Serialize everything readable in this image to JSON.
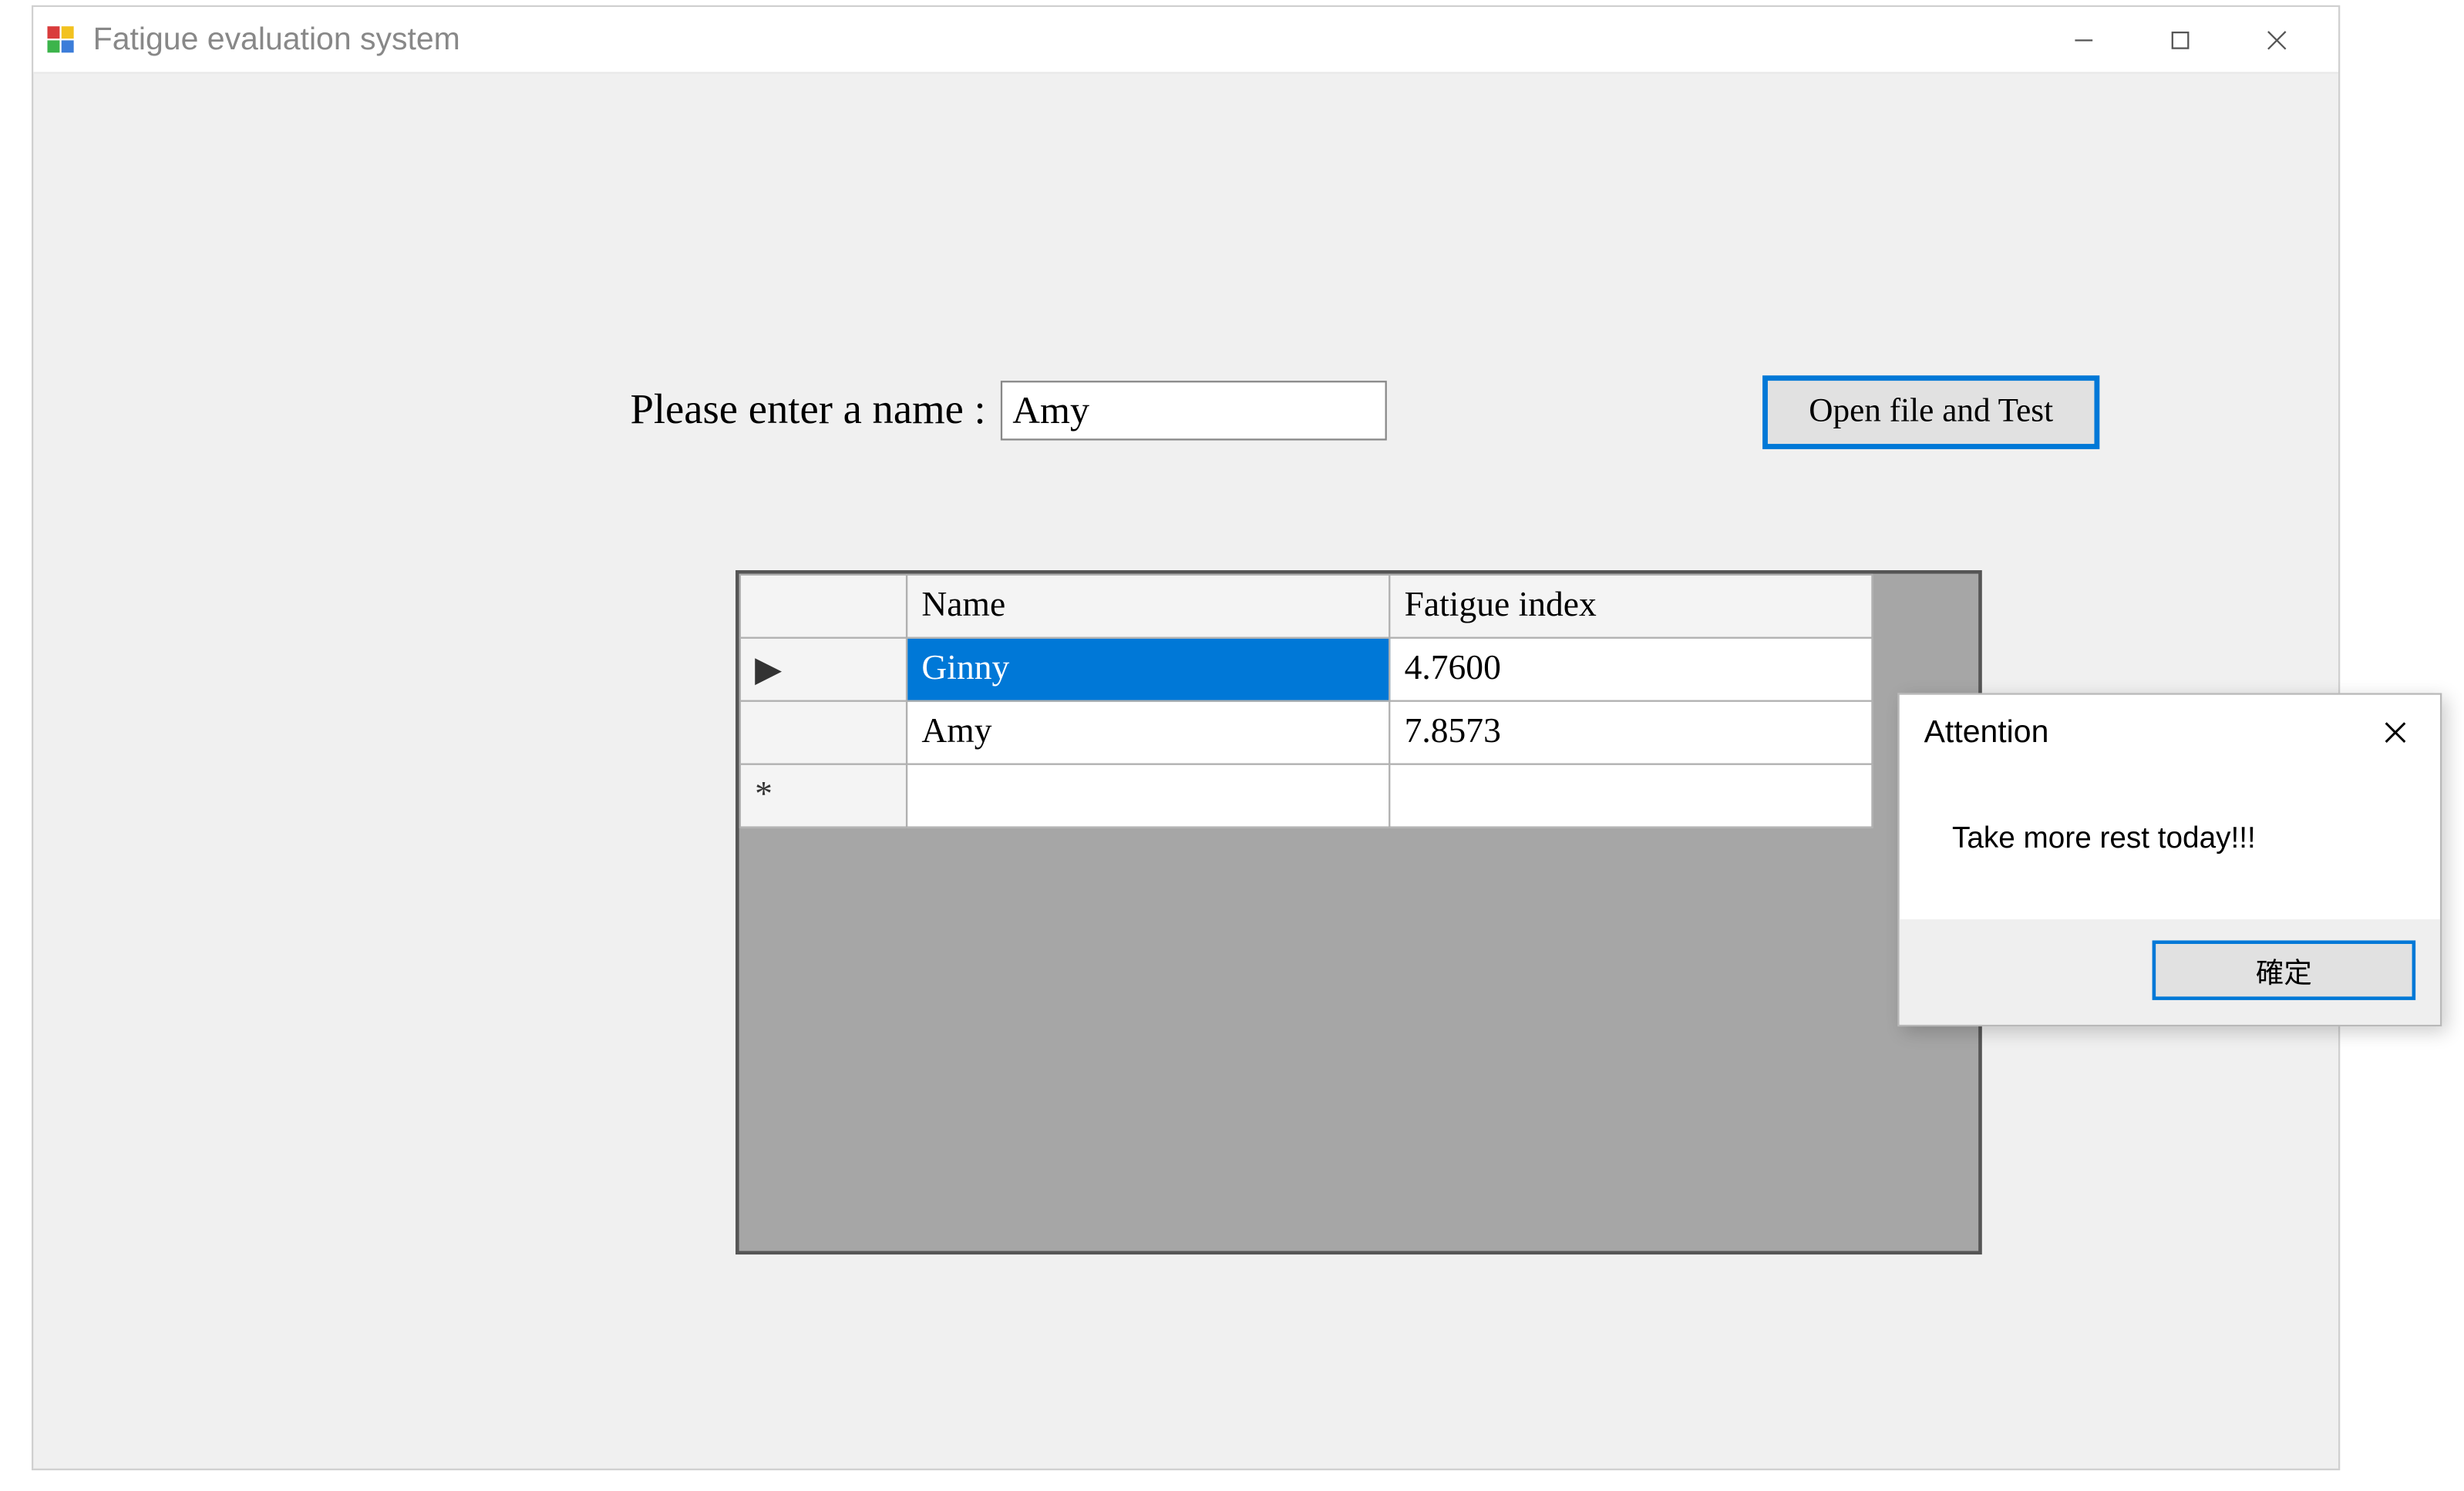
{
  "window": {
    "title": "Fatigue evaluation system"
  },
  "form": {
    "name_label": "Please enter a name :",
    "name_value": "Amy",
    "open_button_label": "Open file and Test"
  },
  "grid": {
    "columns": {
      "row_header": "",
      "name": "Name",
      "fatigue": "Fatigue index"
    },
    "rows": [
      {
        "indicator": "▶",
        "name": "Ginny",
        "fatigue": "4.7600",
        "selected_col": "name"
      },
      {
        "indicator": "",
        "name": "Amy",
        "fatigue": "7.8573",
        "selected_col": null
      },
      {
        "indicator": "*",
        "name": "",
        "fatigue": "",
        "selected_col": null
      }
    ]
  },
  "dialog": {
    "title": "Attention",
    "message": "Take more rest today!!!",
    "ok_label": "確定"
  }
}
